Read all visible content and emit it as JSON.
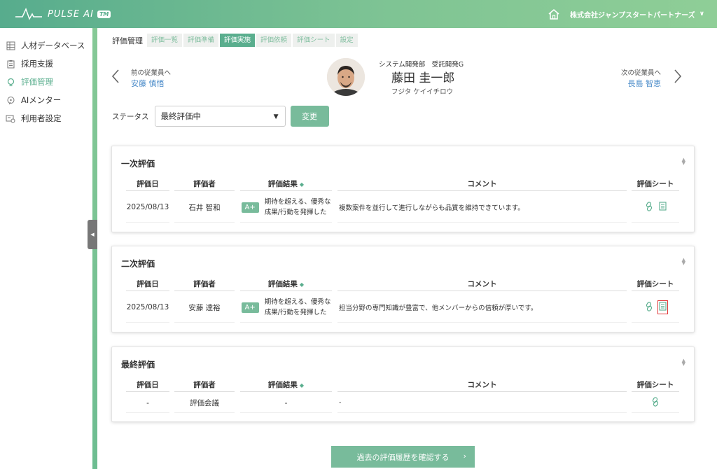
{
  "header": {
    "logo_text": "PULSE AI",
    "logo_badge": "TM",
    "company_name": "株式会社ジャンプスタートパートナーズ",
    "company_chevron": "∨"
  },
  "sidebar": {
    "items": [
      {
        "label": "人材データベース",
        "icon": "database-icon"
      },
      {
        "label": "採用支援",
        "icon": "clipboard-icon"
      },
      {
        "label": "評価管理",
        "icon": "lightbulb-icon",
        "active": true
      },
      {
        "label": "AIメンター",
        "icon": "ai-mentor-icon"
      },
      {
        "label": "利用者設定",
        "icon": "user-settings-icon"
      }
    ]
  },
  "tabs": {
    "title": "評価管理",
    "items": [
      "評価一覧",
      "評価準備",
      "評価実施",
      "評価依頼",
      "評価シート",
      "設定"
    ],
    "active_index": 2
  },
  "employee": {
    "prev_label": "前の従業員へ",
    "prev_name": "安藤 慎悟",
    "next_label": "次の従業員へ",
    "next_name": "長島 智恵",
    "department": "システム開発部　受託開発G",
    "name": "藤田 圭一郎",
    "kana": "フジタ ケイイチロウ"
  },
  "status": {
    "label": "ステータス",
    "value": "最終評価中",
    "change_button": "変更"
  },
  "table_headers": {
    "date": "評価日",
    "evaluator": "評価者",
    "result": "評価結果",
    "comment": "コメント",
    "sheet": "評価シート"
  },
  "sections": [
    {
      "title": "一次評価",
      "date": "2025/08/13",
      "evaluator": "石井 智和",
      "grade": "A+",
      "result_line1": "期待を超える、優秀な",
      "result_line2": "成果/行動を発揮した",
      "comment": "複数案件を並行して進行しながらも品質を維持できています。"
    },
    {
      "title": "二次評価",
      "date": "2025/08/13",
      "evaluator": "安藤 達裕",
      "grade": "A+",
      "result_line1": "期待を超える、優秀な",
      "result_line2": "成果/行動を発揮した",
      "comment": "担当分野の専門知識が豊富で、他メンバーからの信頼が厚いです。"
    },
    {
      "title": "最終評価",
      "date": "-",
      "evaluator": "評価会議",
      "result": "-",
      "comment": "-"
    }
  ],
  "history_button": "過去の評価履歴を確認する",
  "colors": {
    "brand": "#5aae8e",
    "button": "#78bb9b",
    "link": "#4a8bc9",
    "highlight": "#e03a3a"
  }
}
